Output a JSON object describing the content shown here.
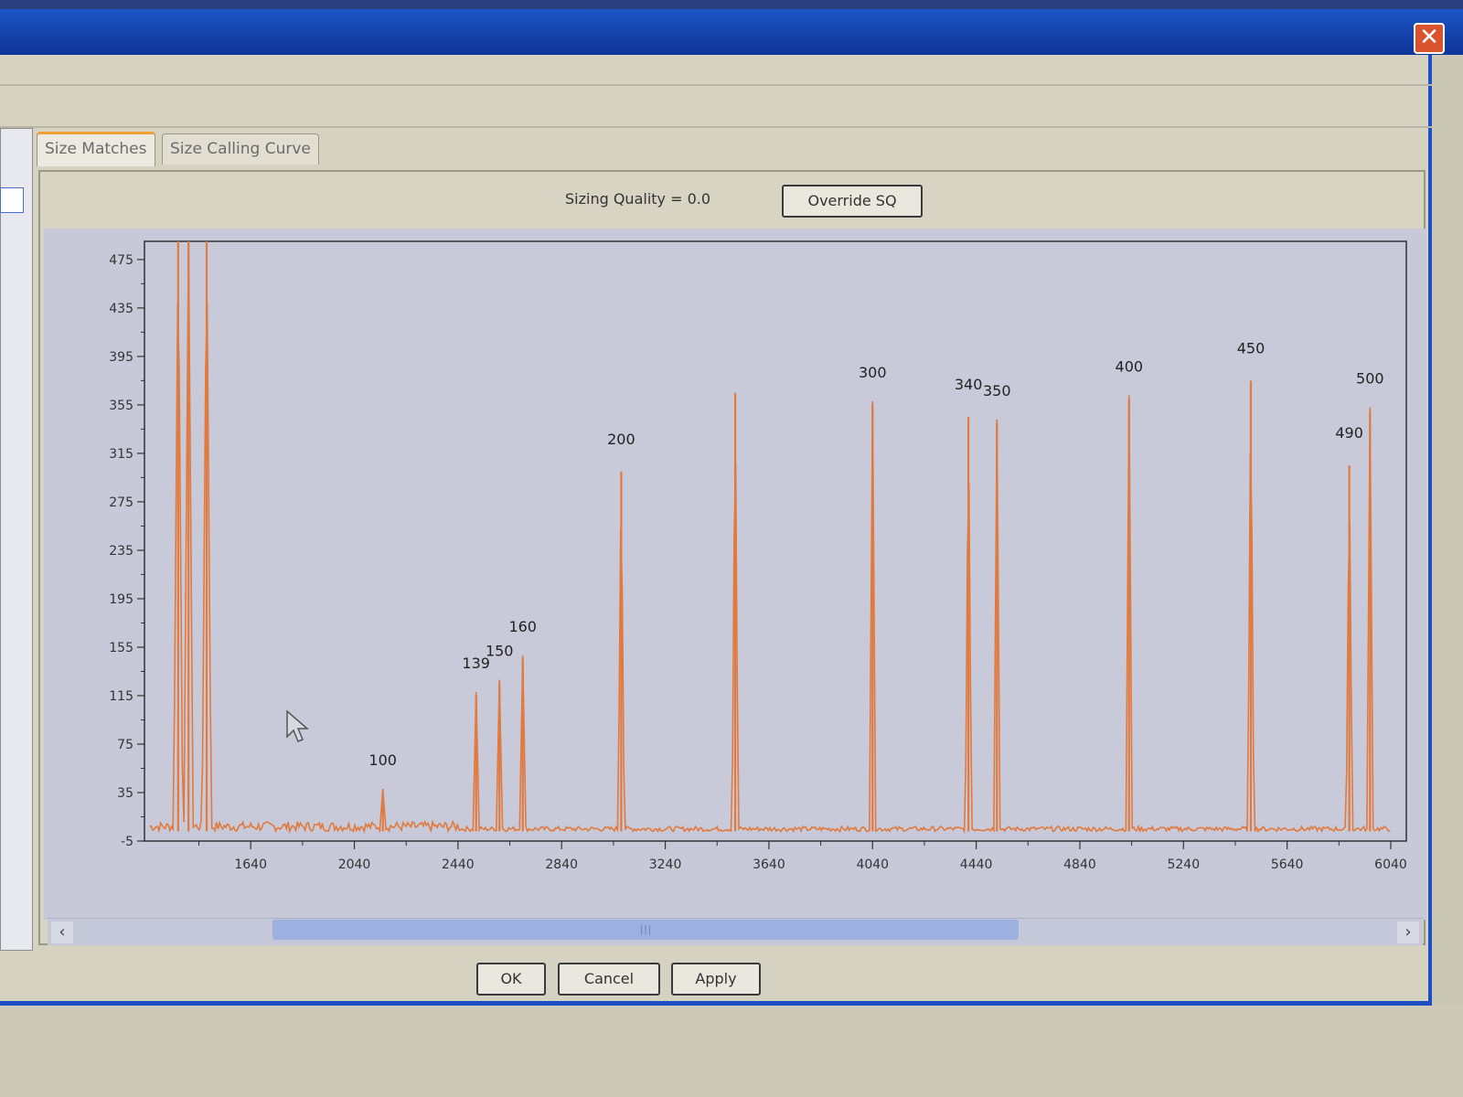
{
  "window": {
    "close_glyph": "✕"
  },
  "tabs": [
    {
      "label": "Size Matches",
      "active": true
    },
    {
      "label": "Size Calling Curve",
      "active": false
    }
  ],
  "sizing": {
    "label": "Sizing Quality = 0.0",
    "override_label": "Override SQ"
  },
  "buttons": {
    "ok": "OK",
    "cancel": "Cancel",
    "apply": "Apply"
  },
  "scroll": {
    "left_glyph": "‹",
    "right_glyph": "›",
    "grip": "|||"
  },
  "colors": {
    "trace": "#e07a3e",
    "plot_bg": "#c9cad9"
  },
  "chart_data": {
    "type": "line",
    "title": "",
    "xlabel": "",
    "ylabel": "",
    "xlim": [
      1230,
      6100
    ],
    "ylim": [
      -5,
      490
    ],
    "x_ticks": [
      1640,
      2040,
      2440,
      2840,
      3240,
      3640,
      4040,
      4440,
      4840,
      5240,
      5640,
      6040
    ],
    "y_ticks": [
      -5,
      35,
      75,
      115,
      155,
      195,
      235,
      275,
      315,
      355,
      395,
      435,
      475
    ],
    "series": [
      {
        "name": "",
        "peaks": [
          {
            "x": 1360,
            "y": 490,
            "label": ""
          },
          {
            "x": 1400,
            "y": 490,
            "label": ""
          },
          {
            "x": 1470,
            "y": 490,
            "label": ""
          },
          {
            "x": 2150,
            "y": 35,
            "label": "100"
          },
          {
            "x": 2510,
            "y": 115,
            "label": "139"
          },
          {
            "x": 2600,
            "y": 125,
            "label": "150"
          },
          {
            "x": 2690,
            "y": 145,
            "label": "160"
          },
          {
            "x": 3070,
            "y": 300,
            "label": "200"
          },
          {
            "x": 3510,
            "y": 365,
            "label": ""
          },
          {
            "x": 4040,
            "y": 355,
            "label": "300"
          },
          {
            "x": 4410,
            "y": 345,
            "label": "340"
          },
          {
            "x": 4520,
            "y": 340,
            "label": "350"
          },
          {
            "x": 5030,
            "y": 360,
            "label": "400"
          },
          {
            "x": 5500,
            "y": 375,
            "label": "450"
          },
          {
            "x": 5880,
            "y": 305,
            "label": "490"
          },
          {
            "x": 5960,
            "y": 350,
            "label": "500"
          }
        ]
      }
    ]
  }
}
